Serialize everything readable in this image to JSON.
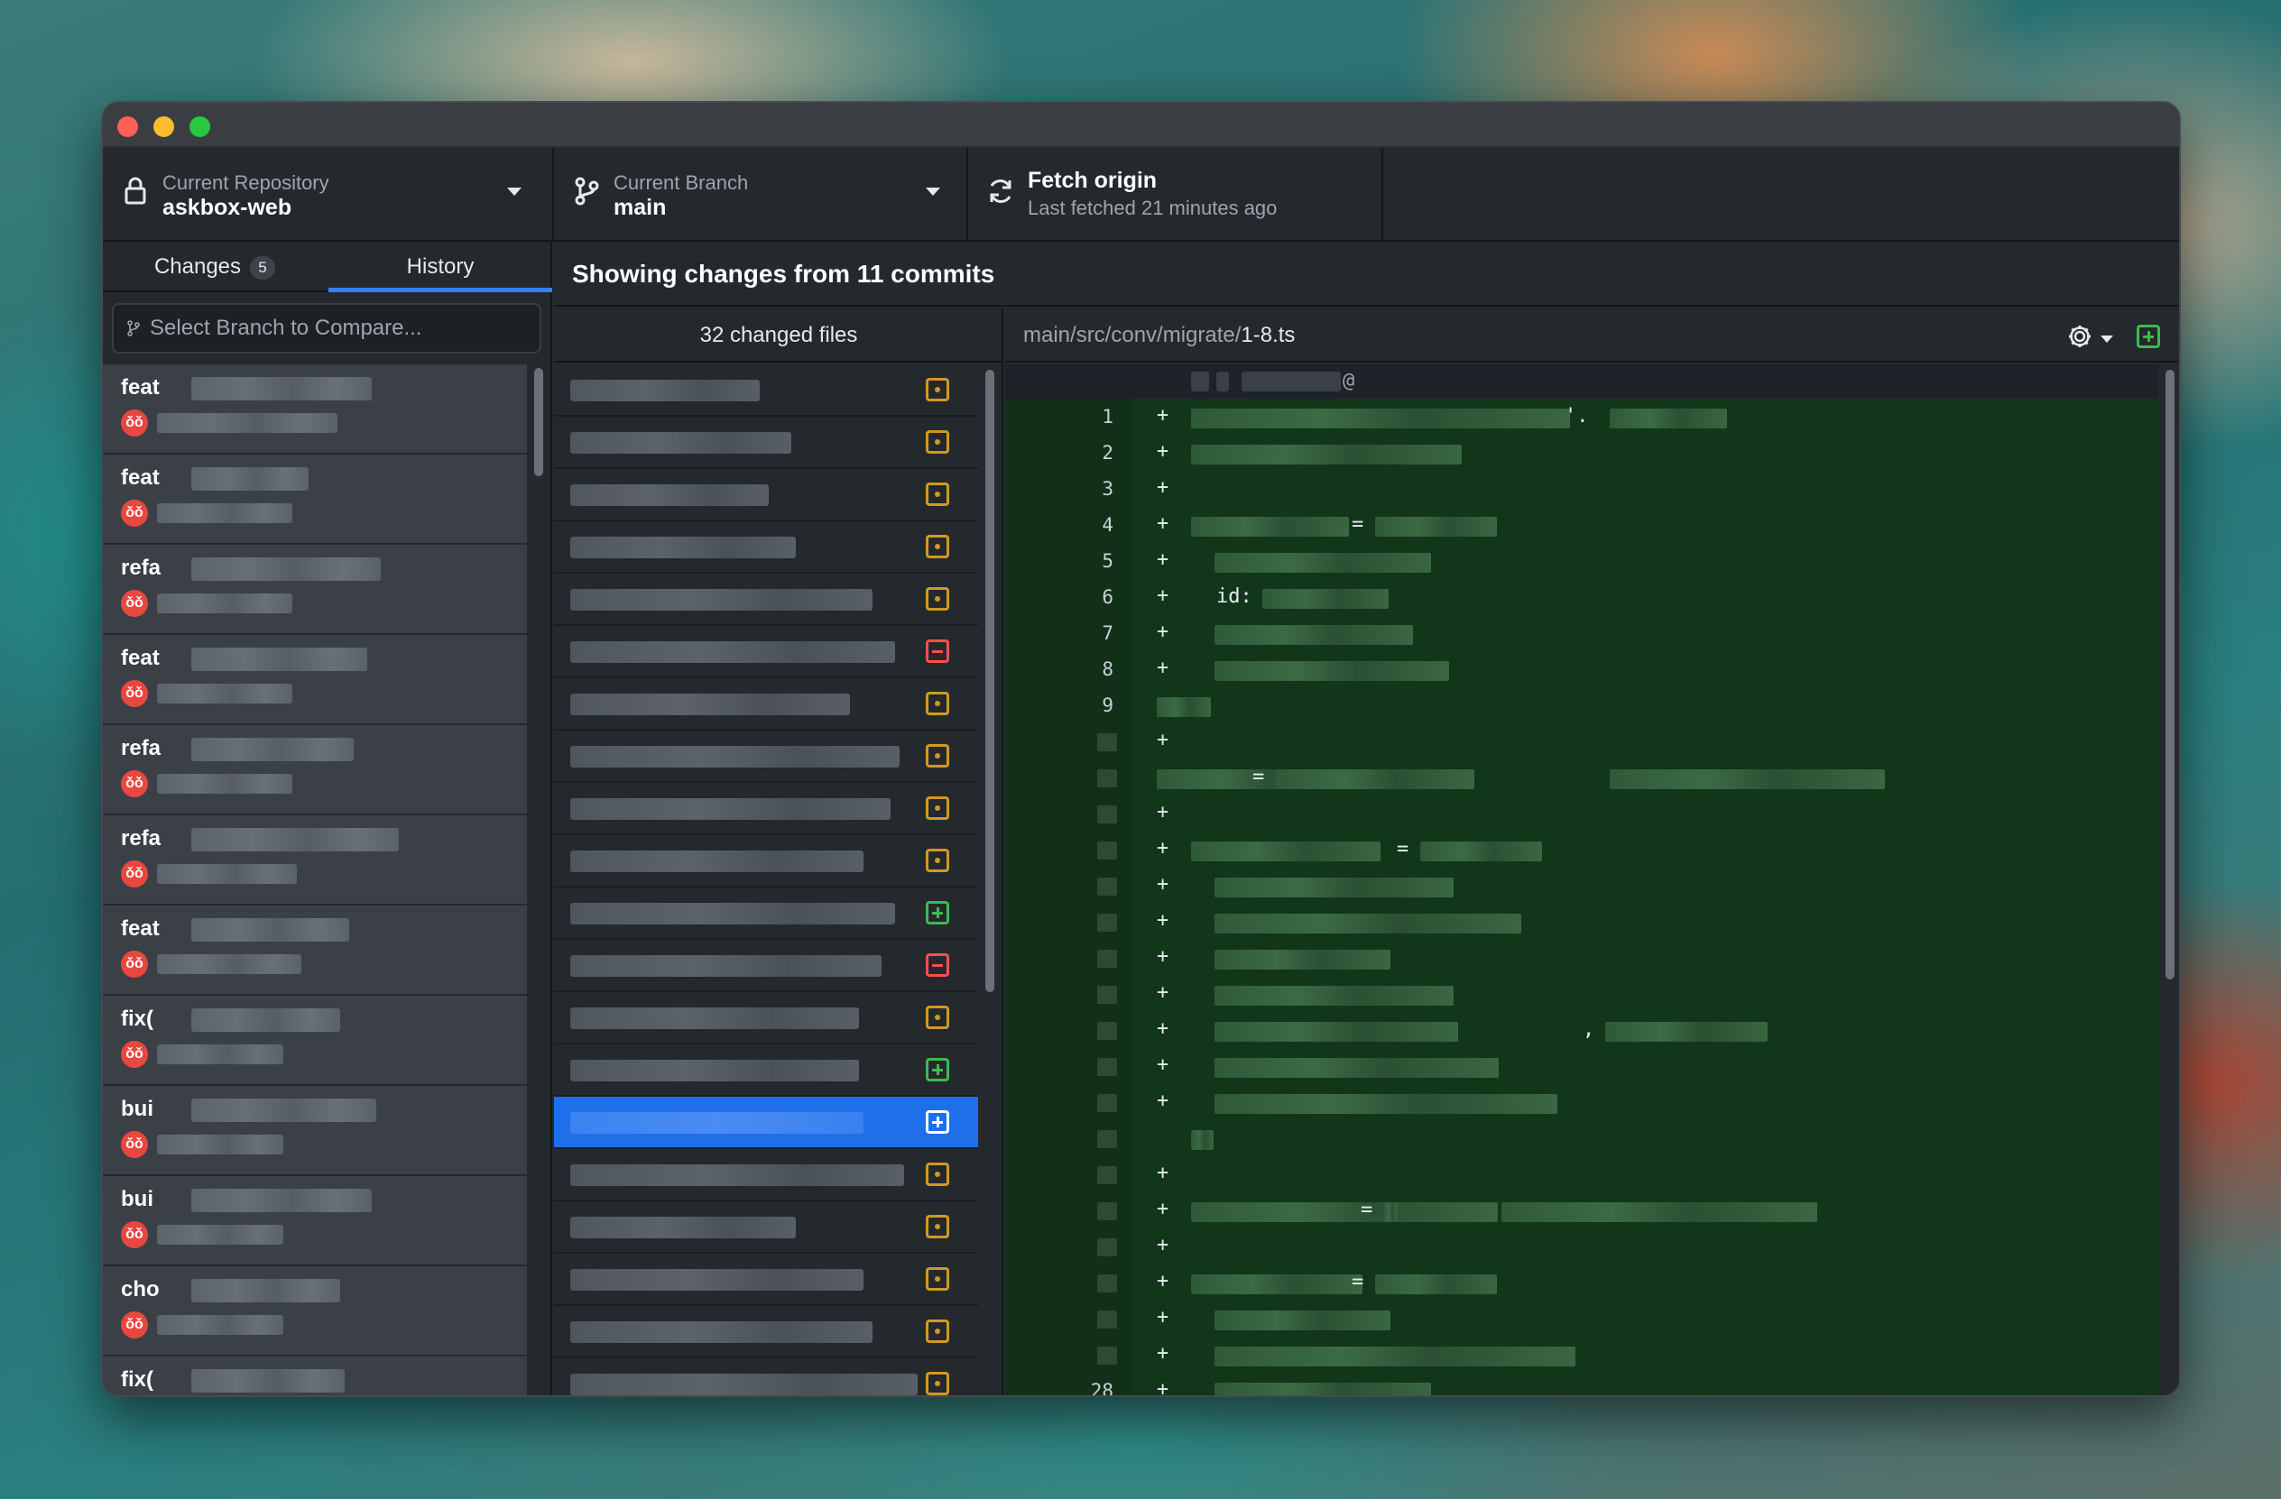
{
  "toolbar": {
    "repo_label": "Current Repository",
    "repo_value": "askbox-web",
    "branch_label": "Current Branch",
    "branch_value": "main",
    "fetch_label": "Fetch origin",
    "fetch_sub": "Last fetched 21 minutes ago"
  },
  "tabs": {
    "changes": "Changes",
    "changes_count": "5",
    "history": "History"
  },
  "compare": {
    "placeholder": "Select Branch to Compare..."
  },
  "header": {
    "title": "Showing changes from 11 commits"
  },
  "files": {
    "count_label": "32 changed files",
    "statuses": [
      "mod",
      "mod",
      "mod",
      "mod",
      "mod",
      "del",
      "mod",
      "mod",
      "mod",
      "mod",
      "add",
      "del",
      "mod",
      "add",
      "add",
      "mod",
      "mod",
      "mod",
      "mod",
      "mod"
    ],
    "selected_index": 14
  },
  "commits": [
    {
      "prefix": "feat"
    },
    {
      "prefix": "feat"
    },
    {
      "prefix": "refa"
    },
    {
      "prefix": "feat"
    },
    {
      "prefix": "refa"
    },
    {
      "prefix": "refa"
    },
    {
      "prefix": "feat"
    },
    {
      "prefix": "fix("
    },
    {
      "prefix": "bui"
    },
    {
      "prefix": "bui"
    },
    {
      "prefix": "cho"
    },
    {
      "prefix": "fix("
    }
  ],
  "avatar_glyph": "ǒǒ",
  "diff": {
    "path_prefix": "main/src/conv/migrate/",
    "path_file": "1-8.ts",
    "hunk_glyph": "@",
    "lines": [
      {
        "n": "1",
        "t": "+",
        "code": "'."
      },
      {
        "n": "2",
        "t": "+",
        "code": ""
      },
      {
        "n": "3",
        "t": "+",
        "code": ""
      },
      {
        "n": "4",
        "t": "+",
        "code": "="
      },
      {
        "n": "5",
        "t": "+",
        "code": ""
      },
      {
        "n": "6",
        "t": "+",
        "code": "id:"
      },
      {
        "n": "7",
        "t": "+",
        "code": ""
      },
      {
        "n": "8",
        "t": "+",
        "code": ""
      },
      {
        "n": "9",
        "t": "",
        "code": ""
      },
      {
        "n": "",
        "t": "+",
        "code": ""
      },
      {
        "n": "",
        "t": "",
        "code": "="
      },
      {
        "n": "",
        "t": "+",
        "code": ""
      },
      {
        "n": "",
        "t": "+",
        "code": "="
      },
      {
        "n": "",
        "t": "+",
        "code": ""
      },
      {
        "n": "",
        "t": "+",
        "code": ""
      },
      {
        "n": "",
        "t": "+",
        "code": ""
      },
      {
        "n": "",
        "t": "+",
        "code": ""
      },
      {
        "n": "",
        "t": "+",
        "code": ","
      },
      {
        "n": "",
        "t": "+",
        "code": ""
      },
      {
        "n": "",
        "t": "+",
        "code": ""
      },
      {
        "n": "",
        "t": "",
        "code": ""
      },
      {
        "n": "",
        "t": "+",
        "code": ""
      },
      {
        "n": "",
        "t": "+",
        "code": "="
      },
      {
        "n": "",
        "t": "+",
        "code": ""
      },
      {
        "n": "",
        "t": "+",
        "code": "="
      },
      {
        "n": "",
        "t": "+",
        "code": ""
      },
      {
        "n": "",
        "t": "+",
        "code": ""
      },
      {
        "n": "28",
        "t": "+",
        "code": ""
      }
    ]
  }
}
